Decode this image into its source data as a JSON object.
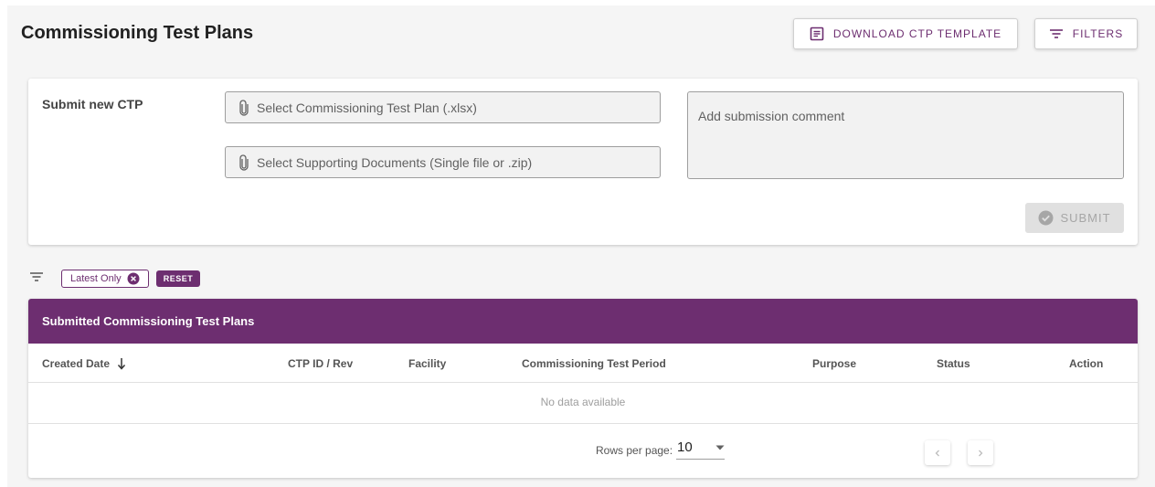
{
  "header": {
    "title": "Commissioning Test Plans",
    "download_label": "DOWNLOAD CTP TEMPLATE",
    "filters_label": "FILTERS"
  },
  "submit": {
    "label": "Submit new CTP",
    "ctp_file_placeholder": "Select Commissioning Test Plan (.xlsx)",
    "docs_file_placeholder": "Select Supporting Documents (Single file or .zip)",
    "comment_placeholder": "Add submission comment",
    "submit_label": "SUBMIT"
  },
  "filters": {
    "chip_label": "Latest Only",
    "reset_label": "RESET"
  },
  "table": {
    "title": "Submitted Commissioning Test Plans",
    "columns": [
      "Created Date",
      "CTP ID / Rev",
      "Facility",
      "Commissioning Test Period",
      "Purpose",
      "Status",
      "Action"
    ],
    "empty_text": "No data available",
    "rows_per_page_label": "Rows per page:",
    "rows_per_page_value": "10"
  },
  "colors": {
    "accent": "#6d2e70",
    "disabled": "#e0e0e0"
  },
  "icons": {
    "download": "document-list-icon",
    "filters": "filter-lines-icon",
    "attach": "paperclip-icon",
    "submit": "check-circle-icon",
    "chip_close": "close-circle-icon",
    "sort": "arrow-down-icon",
    "select": "caret-down-icon",
    "prev": "chevron-left-icon",
    "next": "chevron-right-icon"
  }
}
